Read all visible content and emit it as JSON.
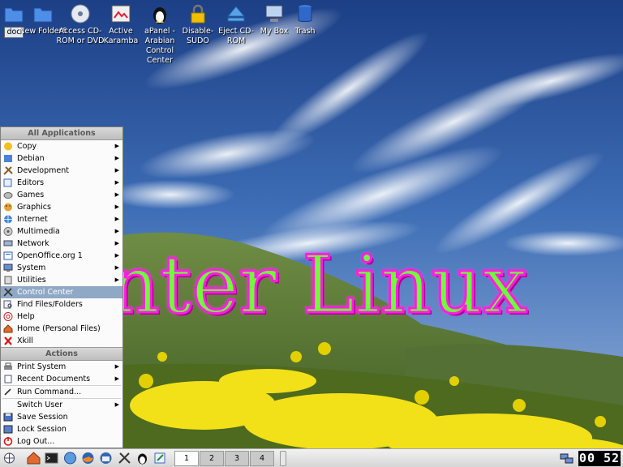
{
  "desktop": {
    "icons": [
      {
        "label": "doc",
        "icon": "folder-icon"
      },
      {
        "label": "New Folder6",
        "icon": "folder-icon"
      },
      {
        "label": "Access CD-ROM or DVD",
        "icon": "cdrom-icon"
      },
      {
        "label": "Active Karamba",
        "icon": "karamba-icon"
      },
      {
        "label": "aPanel - Arabian Control Center",
        "icon": "tux-icon"
      },
      {
        "label": "Disable-SUDO",
        "icon": "lock-icon"
      },
      {
        "label": "Eject CD-ROM",
        "icon": "eject-cdrom-icon"
      },
      {
        "label": "My Box",
        "icon": "computer-icon"
      },
      {
        "label": "Trash",
        "icon": "trash-icon"
      }
    ],
    "banner": "Inter Linux"
  },
  "menu": {
    "header_apps": "All Applications",
    "apps": [
      {
        "label": "Copy",
        "submenu": true
      },
      {
        "label": "Debian",
        "submenu": true
      },
      {
        "label": "Development",
        "submenu": true
      },
      {
        "label": "Editors",
        "submenu": true
      },
      {
        "label": "Games",
        "submenu": true
      },
      {
        "label": "Graphics",
        "submenu": true
      },
      {
        "label": "Internet",
        "submenu": true
      },
      {
        "label": "Multimedia",
        "submenu": true
      },
      {
        "label": "Network",
        "submenu": true
      },
      {
        "label": "OpenOffice.org 1",
        "submenu": true
      },
      {
        "label": "System",
        "submenu": true
      },
      {
        "label": "Utilities",
        "submenu": true
      },
      {
        "label": "Control Center",
        "submenu": false
      },
      {
        "label": "Find Files/Folders",
        "submenu": false
      },
      {
        "label": "Help",
        "submenu": false
      },
      {
        "label": "Home (Personal Files)",
        "submenu": false
      },
      {
        "label": "Xkill",
        "submenu": false
      }
    ],
    "active_item": "Control Center",
    "header_actions": "Actions",
    "actions": [
      {
        "label": "Print System",
        "submenu": true
      },
      {
        "label": "Recent Documents",
        "submenu": true
      },
      {
        "label": "Run Command...",
        "submenu": false
      },
      {
        "label": "Switch User",
        "submenu": true
      },
      {
        "label": "Save Session",
        "submenu": false
      },
      {
        "label": "Lock Session",
        "submenu": false
      },
      {
        "label": "Log Out...",
        "submenu": false
      }
    ]
  },
  "taskbar": {
    "launchers": [
      "kmenu-icon",
      "home-icon",
      "terminal-icon",
      "konqueror-icon",
      "firefox-icon",
      "thunderbird-icon",
      "tools-icon",
      "tux-icon",
      "editor-icon"
    ],
    "desktops": [
      "1",
      "2",
      "3",
      "4"
    ],
    "current_desktop": "1",
    "clock": "00 52"
  }
}
